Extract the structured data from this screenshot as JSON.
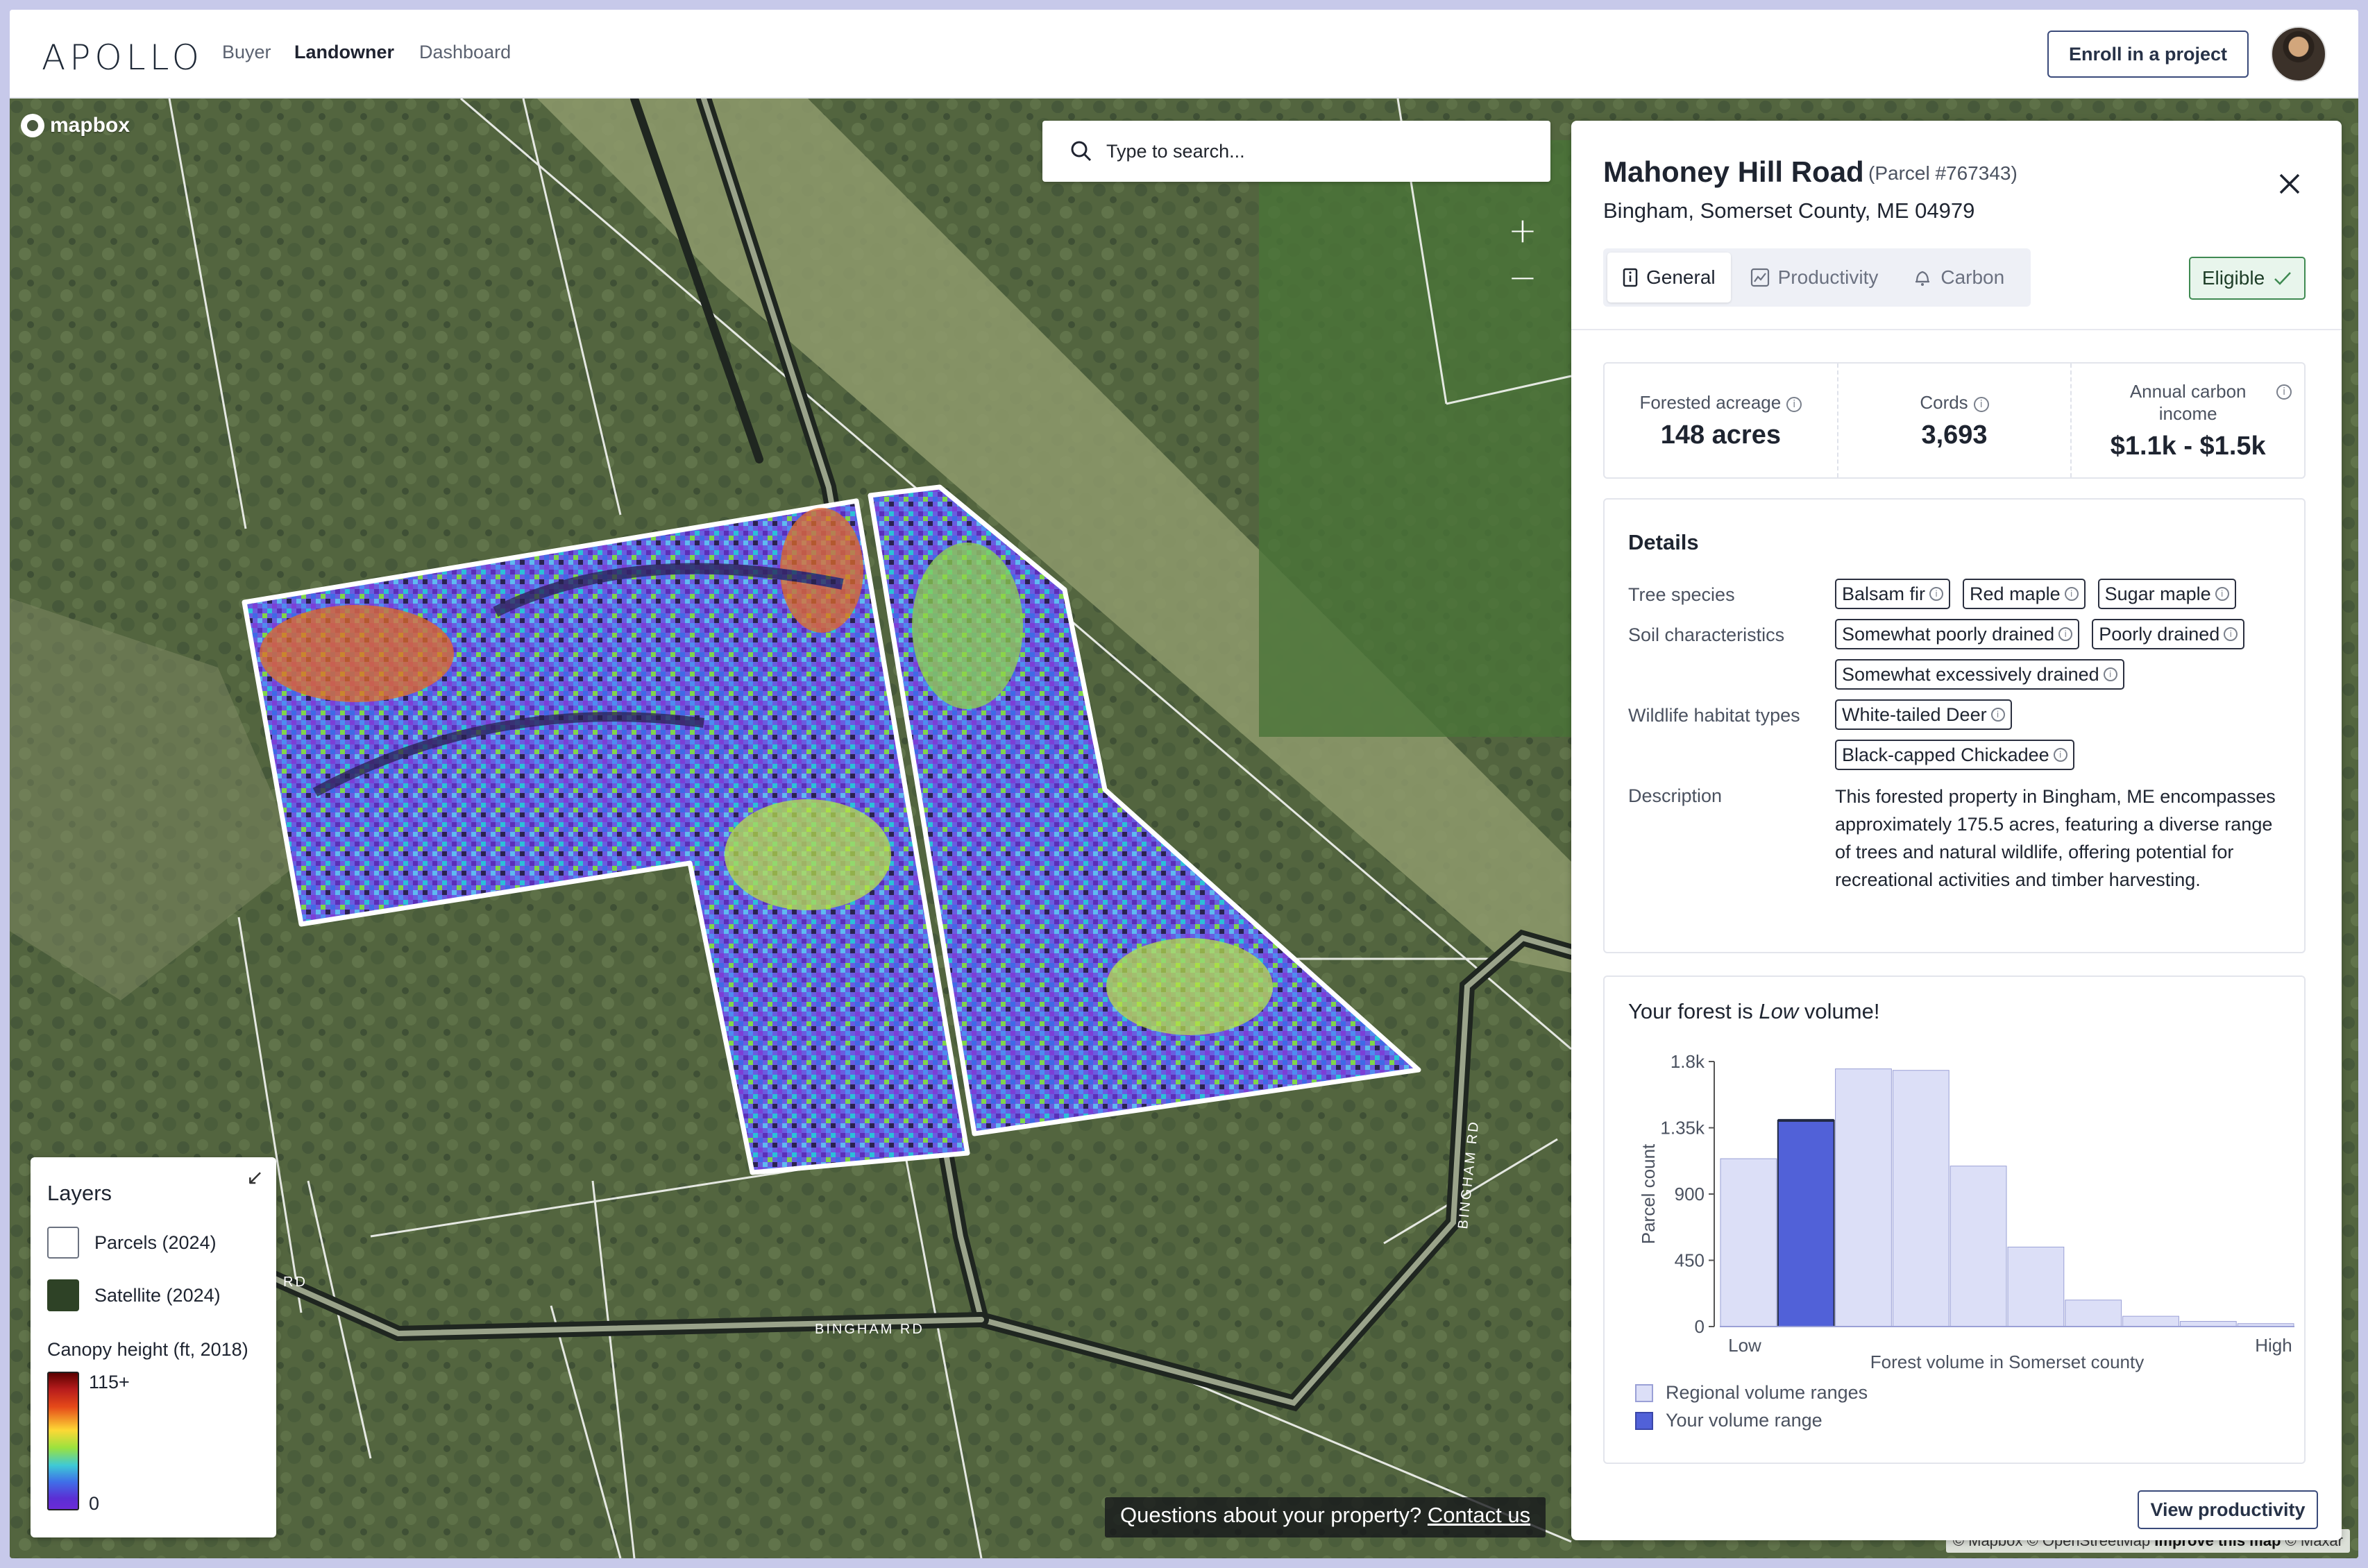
{
  "header": {
    "logo": "APOLLO",
    "nav": [
      {
        "label": "Buyer",
        "active": false
      },
      {
        "label": "Landowner",
        "active": true
      },
      {
        "label": "Dashboard",
        "active": false
      }
    ],
    "enroll_label": "Enroll in a project"
  },
  "map": {
    "brand": "mapbox",
    "search_placeholder": "Type to search...",
    "zoom_in": "+",
    "zoom_out": "−",
    "road_labels": [
      "RD",
      "BINGHAM RD",
      "BINGHAM RD"
    ],
    "contact_text": "Questions about your property?",
    "contact_link": "Contact us",
    "attribution": {
      "prefix": "© Mapbox © OpenStreetMap",
      "improve": "Improve this map",
      "suffix": "© Maxar"
    }
  },
  "layers": {
    "title": "Layers",
    "items": [
      {
        "label": "Parcels (2024)"
      },
      {
        "label": "Satellite (2024)"
      }
    ],
    "canopy_title": "Canopy height (ft, 2018)",
    "canopy_max": "115+",
    "canopy_min": "0"
  },
  "panel": {
    "title": "Mahoney Hill Road",
    "parcel_id": "(Parcel #767343)",
    "address": "Bingham, Somerset County, ME 04979",
    "tabs": [
      {
        "label": "General",
        "active": true
      },
      {
        "label": "Productivity",
        "active": false
      },
      {
        "label": "Carbon",
        "active": false
      }
    ],
    "eligible": "Eligible",
    "stats": [
      {
        "label": "Forested acreage",
        "value": "148 acres"
      },
      {
        "label": "Cords",
        "value": "3,693"
      },
      {
        "label": "Annual carbon income",
        "value": "$1.1k - $1.5k"
      }
    ],
    "details": {
      "title": "Details",
      "tree_species_label": "Tree species",
      "tree_species": [
        "Balsam fir",
        "Red maple",
        "Sugar maple"
      ],
      "soil_label": "Soil characteristics",
      "soil": [
        "Somewhat poorly drained",
        "Poorly drained",
        "Somewhat excessively drained"
      ],
      "wildlife_label": "Wildlife habitat types",
      "wildlife": [
        "White-tailed Deer",
        "Black-capped Chickadee"
      ],
      "description_label": "Description",
      "description": "This forested property in Bingham, ME encompasses approximately 175.5 acres, featuring a diverse range of trees and natural wildlife, offering potential for recreational activities and timber harvesting."
    },
    "chart_title_prefix": "Your forest is ",
    "chart_title_emph": "Low",
    "chart_title_suffix": " volume!",
    "legend": [
      {
        "label": "Regional volume ranges",
        "color": "#dcdff7"
      },
      {
        "label": "Your volume range",
        "color": "#5161d8"
      }
    ],
    "view_productivity": "View productivity"
  },
  "chart_data": {
    "type": "bar",
    "title": "Your forest is Low volume!",
    "xlabel": "Forest volume in Somerset county",
    "ylabel": "Parcel count",
    "x_tick_labels": [
      "Low",
      "High"
    ],
    "y_ticks": [
      "0",
      "450",
      "900",
      "1.35k",
      "1.8k"
    ],
    "y_tick_values": [
      0,
      450,
      900,
      1350,
      1800
    ],
    "ylim": [
      0,
      1800
    ],
    "values": [
      1140,
      1400,
      1750,
      1740,
      1090,
      540,
      180,
      70,
      35,
      20
    ],
    "highlight_index": 1,
    "colors": {
      "regional": "#dcdff7",
      "regional_stroke": "#9aa0d6",
      "yours": "#5161d8",
      "yours_stroke": "#222a44"
    }
  }
}
